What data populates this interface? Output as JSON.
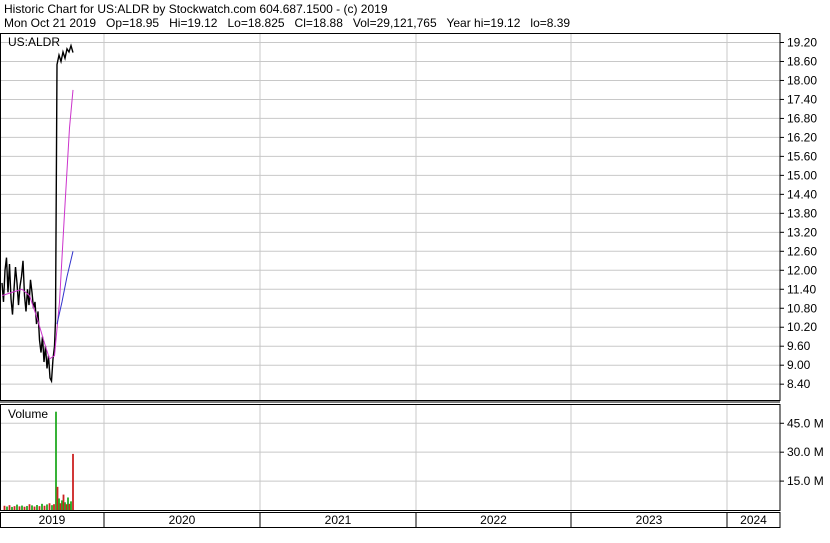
{
  "header": {
    "line1": "Historic Chart for US:ALDR by Stockwatch.com 604.687.1500 - (c) 2019",
    "line2": "Mon Oct 21 2019   Op=18.95   Hi=19.12   Lo=18.825   Cl=18.88   Vol=29,121,765   Year hi=19.12   lo=8.39"
  },
  "colors": {
    "price": "#000000",
    "ma_short": "#cc33cc",
    "ma_long": "#3333cc",
    "vol_up": "#22aa22",
    "vol_down": "#cc2222",
    "grid": "#c8c8c8"
  },
  "chart_data": [
    {
      "type": "line",
      "title": "US:ALDR",
      "x_categories": [
        "2019",
        "2020",
        "2021",
        "2022",
        "2023",
        "2024"
      ],
      "y_ticks": [
        "19.20",
        "18.60",
        "18.00",
        "17.40",
        "16.80",
        "16.20",
        "15.60",
        "15.00",
        "14.40",
        "13.80",
        "13.20",
        "12.60",
        "12.00",
        "11.40",
        "10.80",
        "10.20",
        "9.60",
        "9.00",
        "8.40"
      ],
      "ylim": [
        7.9,
        19.5
      ],
      "grid": true,
      "series": [
        {
          "role": "price",
          "points": [
            [
              0.0,
              11.6
            ],
            [
              0.3,
              11.0
            ],
            [
              0.6,
              12.0
            ],
            [
              0.9,
              12.4
            ],
            [
              1.2,
              11.3
            ],
            [
              1.5,
              12.2
            ],
            [
              1.8,
              11.1
            ],
            [
              2.1,
              10.6
            ],
            [
              2.4,
              11.4
            ],
            [
              2.7,
              12.1
            ],
            [
              3.0,
              11.6
            ],
            [
              3.3,
              10.9
            ],
            [
              3.6,
              11.5
            ],
            [
              3.9,
              11.8
            ],
            [
              4.2,
              12.3
            ],
            [
              4.5,
              11.2
            ],
            [
              4.8,
              10.7
            ],
            [
              5.1,
              11.4
            ],
            [
              5.4,
              10.9
            ],
            [
              5.7,
              11.7
            ],
            [
              6.0,
              11.3
            ],
            [
              6.3,
              10.8
            ],
            [
              6.6,
              11.0
            ],
            [
              6.9,
              10.3
            ],
            [
              7.2,
              10.7
            ],
            [
              7.5,
              9.8
            ],
            [
              7.8,
              9.4
            ],
            [
              8.1,
              9.9
            ],
            [
              8.4,
              9.1
            ],
            [
              8.7,
              9.6
            ],
            [
              9.0,
              8.9
            ],
            [
              9.3,
              9.3
            ],
            [
              9.6,
              8.6
            ],
            [
              9.9,
              8.5
            ],
            [
              10.2,
              9.2
            ],
            [
              10.5,
              9.6
            ],
            [
              10.7,
              10.4
            ],
            [
              11.0,
              18.5
            ],
            [
              11.4,
              18.8
            ],
            [
              11.8,
              18.6
            ],
            [
              12.2,
              18.9
            ],
            [
              12.6,
              18.7
            ],
            [
              13.0,
              19.0
            ],
            [
              13.4,
              18.9
            ],
            [
              13.8,
              19.1
            ],
            [
              14.2,
              18.88
            ]
          ]
        },
        {
          "role": "ma_short",
          "points": [
            [
              0.0,
              11.2
            ],
            [
              2.0,
              11.3
            ],
            [
              4.0,
              11.4
            ],
            [
              5.5,
              11.2
            ],
            [
              7.0,
              10.5
            ],
            [
              8.5,
              9.7
            ],
            [
              9.5,
              9.2
            ],
            [
              10.5,
              9.3
            ],
            [
              11.5,
              11.0
            ],
            [
              12.5,
              13.8
            ],
            [
              13.5,
              16.5
            ],
            [
              14.2,
              17.7
            ]
          ]
        },
        {
          "role": "ma_long",
          "points": [
            [
              11.0,
              10.3
            ],
            [
              12.0,
              11.0
            ],
            [
              13.0,
              11.8
            ],
            [
              14.2,
              12.6
            ]
          ]
        }
      ]
    },
    {
      "type": "bar",
      "title": "Volume",
      "y_ticks": [
        "45.0 M",
        "30.0 M",
        "15.0 M"
      ],
      "ylim": [
        0,
        55
      ],
      "grid": true,
      "bars": [
        {
          "x": 0.5,
          "v": 2.2,
          "up": false
        },
        {
          "x": 1.0,
          "v": 1.8,
          "up": true
        },
        {
          "x": 1.5,
          "v": 2.5,
          "up": false
        },
        {
          "x": 2.0,
          "v": 1.6,
          "up": true
        },
        {
          "x": 2.5,
          "v": 2.0,
          "up": false
        },
        {
          "x": 3.0,
          "v": 2.8,
          "up": true
        },
        {
          "x": 3.5,
          "v": 1.9,
          "up": false
        },
        {
          "x": 4.0,
          "v": 2.3,
          "up": true
        },
        {
          "x": 4.5,
          "v": 1.7,
          "up": false
        },
        {
          "x": 5.0,
          "v": 2.1,
          "up": true
        },
        {
          "x": 5.5,
          "v": 3.0,
          "up": false
        },
        {
          "x": 6.0,
          "v": 2.4,
          "up": true
        },
        {
          "x": 6.5,
          "v": 1.8,
          "up": false
        },
        {
          "x": 7.0,
          "v": 2.6,
          "up": true
        },
        {
          "x": 7.5,
          "v": 2.0,
          "up": false
        },
        {
          "x": 8.0,
          "v": 3.2,
          "up": true
        },
        {
          "x": 8.5,
          "v": 2.2,
          "up": false
        },
        {
          "x": 9.0,
          "v": 2.9,
          "up": true
        },
        {
          "x": 9.5,
          "v": 3.5,
          "up": false
        },
        {
          "x": 10.0,
          "v": 2.5,
          "up": true
        },
        {
          "x": 10.4,
          "v": 3.0,
          "up": false
        },
        {
          "x": 10.8,
          "v": 51.0,
          "up": true
        },
        {
          "x": 11.1,
          "v": 12.0,
          "up": false
        },
        {
          "x": 11.4,
          "v": 6.0,
          "up": true
        },
        {
          "x": 11.7,
          "v": 3.5,
          "up": false
        },
        {
          "x": 12.0,
          "v": 5.0,
          "up": true
        },
        {
          "x": 12.3,
          "v": 8.0,
          "up": false
        },
        {
          "x": 12.6,
          "v": 4.0,
          "up": true
        },
        {
          "x": 12.9,
          "v": 3.0,
          "up": false
        },
        {
          "x": 13.2,
          "v": 6.5,
          "up": true
        },
        {
          "x": 13.5,
          "v": 3.2,
          "up": false
        },
        {
          "x": 13.8,
          "v": 4.5,
          "up": true
        },
        {
          "x": 14.2,
          "v": 29.1,
          "up": false
        }
      ]
    }
  ]
}
